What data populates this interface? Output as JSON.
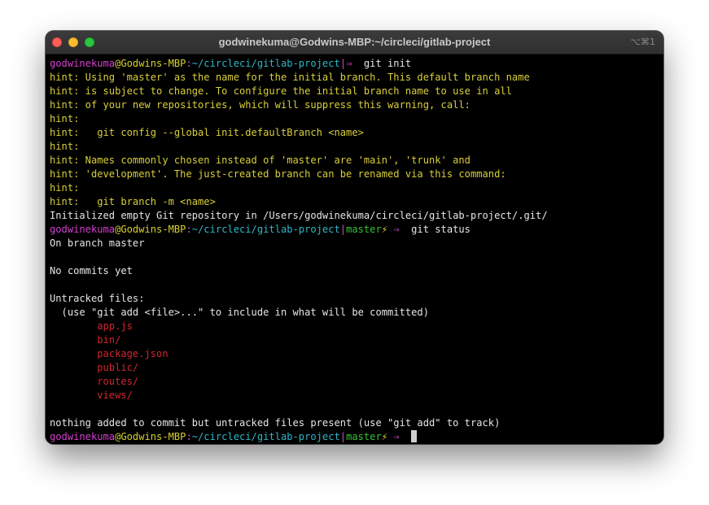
{
  "window": {
    "title": "godwinekuma@Godwins-MBP:~/circleci/gitlab-project",
    "shortcut": "⌥⌘1"
  },
  "prompt": {
    "user": "godwinekuma",
    "at": "@",
    "host": "Godwins-MBP",
    "colon": ":",
    "path": "~/circleci/gitlab-project",
    "separator": "|",
    "branch": "master",
    "bolt": "⚡",
    "arrow": "⇒"
  },
  "commands": {
    "first": "git init",
    "second": "git status"
  },
  "hints": [
    "hint: Using 'master' as the name for the initial branch. This default branch name",
    "hint: is subject to change. To configure the initial branch name to use in all",
    "hint: of your new repositories, which will suppress this warning, call:",
    "hint:",
    "hint:   git config --global init.defaultBranch <name>",
    "hint:",
    "hint: Names commonly chosen instead of 'master' are 'main', 'trunk' and",
    "hint: 'development'. The just-created branch can be renamed via this command:",
    "hint:",
    "hint:   git branch -m <name>"
  ],
  "init_message": "Initialized empty Git repository in /Users/godwinekuma/circleci/gitlab-project/.git/",
  "status": {
    "on_branch": "On branch master",
    "no_commits": "No commits yet",
    "untracked_header": "Untracked files:",
    "untracked_hint": "  (use \"git add <file>...\" to include in what will be committed)",
    "files": [
      "app.js",
      "bin/",
      "package.json",
      "public/",
      "routes/",
      "views/"
    ],
    "summary": "nothing added to commit but untracked files present (use \"git add\" to track)"
  },
  "colors": {
    "user": "#d63fd0",
    "host": "#d8d12d",
    "path": "#2fb7c8",
    "branch": "#35c232",
    "hint": "#d9cf3a",
    "untracked": "#d0262e"
  }
}
